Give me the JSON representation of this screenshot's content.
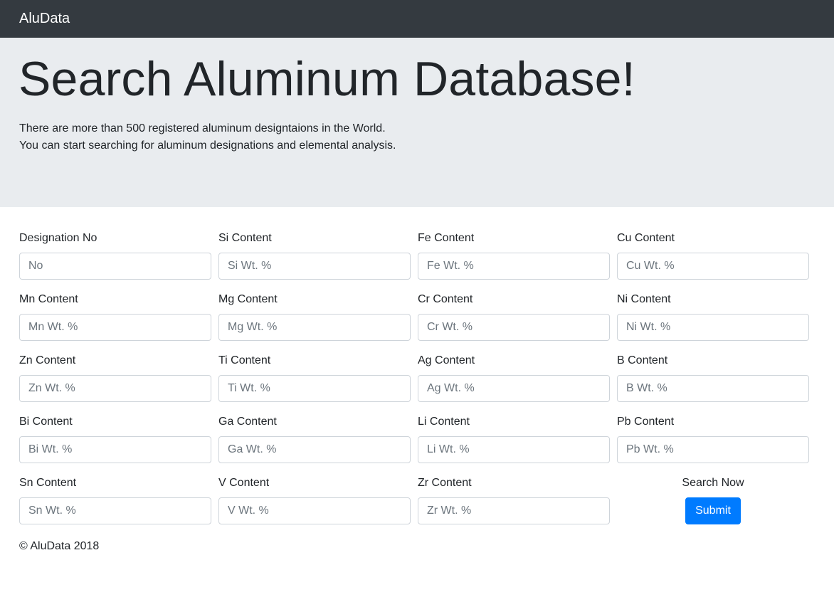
{
  "navbar": {
    "brand": "AluData"
  },
  "hero": {
    "title": "Search Aluminum Database!",
    "line1": "There are more than 500 registered aluminum designtaions in the World.",
    "line2": "You can start searching for aluminum designations and elemental analysis."
  },
  "fields": [
    {
      "label": "Designation No",
      "placeholder": "No"
    },
    {
      "label": "Si Content",
      "placeholder": "Si Wt. %"
    },
    {
      "label": "Fe Content",
      "placeholder": "Fe Wt. %"
    },
    {
      "label": "Cu Content",
      "placeholder": "Cu Wt. %"
    },
    {
      "label": "Mn Content",
      "placeholder": "Mn Wt. %"
    },
    {
      "label": "Mg Content",
      "placeholder": "Mg Wt. %"
    },
    {
      "label": "Cr Content",
      "placeholder": "Cr Wt. %"
    },
    {
      "label": "Ni Content",
      "placeholder": "Ni Wt. %"
    },
    {
      "label": "Zn Content",
      "placeholder": "Zn Wt. %"
    },
    {
      "label": "Ti Content",
      "placeholder": "Ti Wt. %"
    },
    {
      "label": "Ag Content",
      "placeholder": "Ag Wt. %"
    },
    {
      "label": "B Content",
      "placeholder": "B Wt. %"
    },
    {
      "label": "Bi Content",
      "placeholder": "Bi Wt. %"
    },
    {
      "label": "Ga Content",
      "placeholder": "Ga Wt. %"
    },
    {
      "label": "Li Content",
      "placeholder": "Li Wt. %"
    },
    {
      "label": "Pb Content",
      "placeholder": "Pb Wt. %"
    },
    {
      "label": "Sn Content",
      "placeholder": "Sn Wt. %"
    },
    {
      "label": "V Content",
      "placeholder": "V Wt. %"
    },
    {
      "label": "Zr Content",
      "placeholder": "Zr Wt. %"
    }
  ],
  "search": {
    "label": "Search Now",
    "button": "Submit"
  },
  "footer": {
    "text": "© AluData 2018"
  }
}
